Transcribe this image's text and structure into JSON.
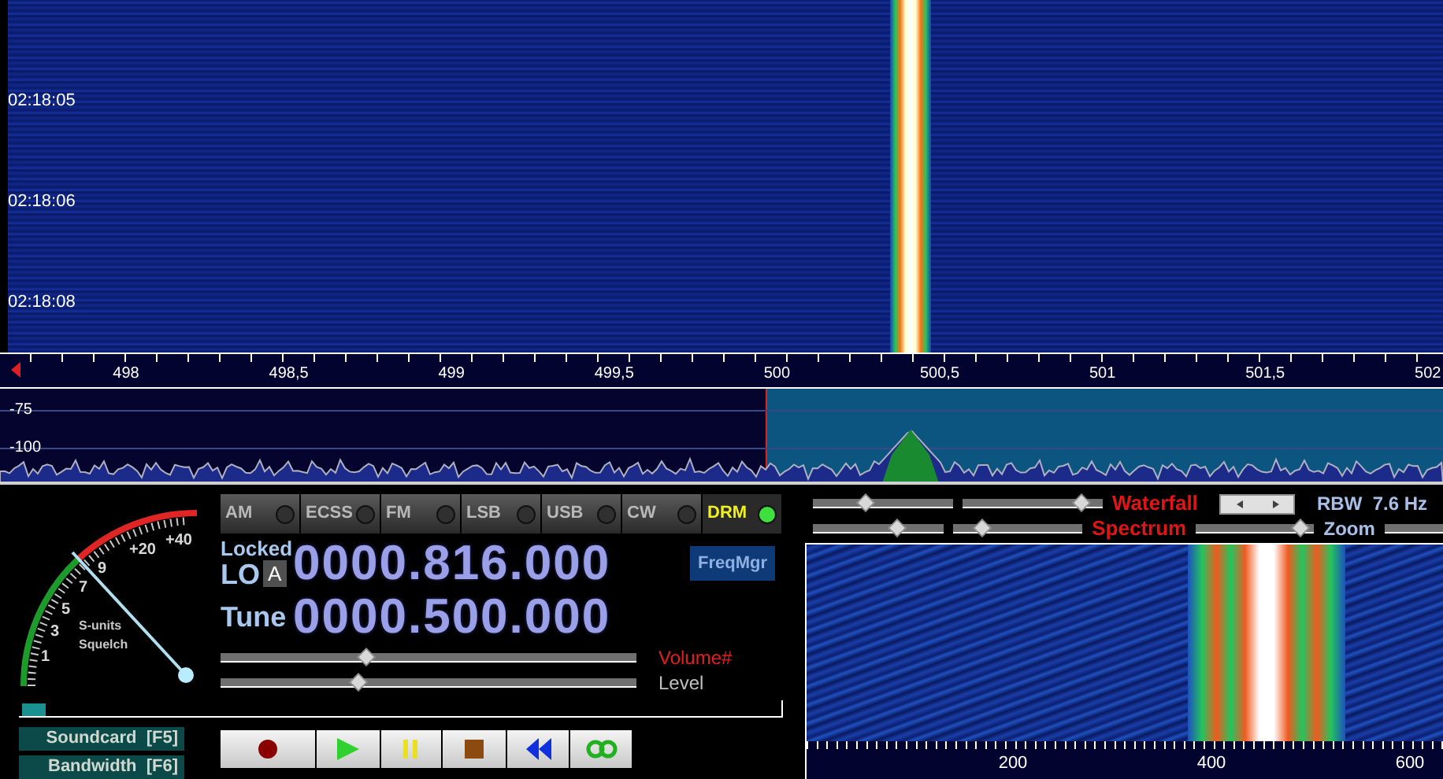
{
  "waterfall": {
    "timestamps": [
      "02:18:05",
      "02:18:06",
      "02:18:08"
    ]
  },
  "frequency_axis": {
    "labels": [
      "498",
      "498,5",
      "499",
      "499,5",
      "500",
      "500,5",
      "501",
      "501,5",
      "502"
    ]
  },
  "spectrum": {
    "db_labels": [
      "-75",
      "-100"
    ]
  },
  "modes": [
    {
      "label": "AM",
      "selected": false
    },
    {
      "label": "ECSS",
      "selected": false
    },
    {
      "label": "FM",
      "selected": false
    },
    {
      "label": "LSB",
      "selected": false
    },
    {
      "label": "USB",
      "selected": false
    },
    {
      "label": "CW",
      "selected": false
    },
    {
      "label": "DRM",
      "selected": true
    }
  ],
  "s_meter": {
    "scale": [
      "1",
      "3",
      "5",
      "7",
      "9",
      "+20",
      "+40"
    ],
    "caption": "S-units",
    "squelch": "Squelch"
  },
  "lo": {
    "status": "Locked",
    "label": "LO",
    "badge": "A",
    "frequency": "0000.816.000"
  },
  "freq_manager": "FreqMgr",
  "tune": {
    "label": "Tune",
    "frequency": "0000.500.000"
  },
  "audio_sliders": [
    {
      "label": "Volume#",
      "highlighted": true,
      "level": 0.35
    },
    {
      "label": "Level",
      "highlighted": false,
      "level": 0.33
    }
  ],
  "input_level": {
    "level": 0.03
  },
  "side_buttons": [
    "Soundcard  [F5]",
    "Bandwidth  [F6]"
  ],
  "transport": [
    {
      "kind": "record"
    },
    {
      "kind": "play"
    },
    {
      "kind": "pause"
    },
    {
      "kind": "stop"
    },
    {
      "kind": "rewind"
    },
    {
      "kind": "loop"
    }
  ],
  "display_controls": [
    {
      "label": "Waterfall",
      "sliders": [
        {
          "level": 0.37
        },
        {
          "level": 0.84
        }
      ]
    },
    {
      "label": "Spectrum",
      "sliders": [
        {
          "level": 0.64
        },
        {
          "level": 0.22
        }
      ]
    }
  ],
  "rbw": "RBW  7.6 Hz",
  "zoom": {
    "label": "Zoom",
    "level": 0.88
  },
  "zoom_axis": {
    "labels": [
      "200",
      "400",
      "600"
    ]
  }
}
